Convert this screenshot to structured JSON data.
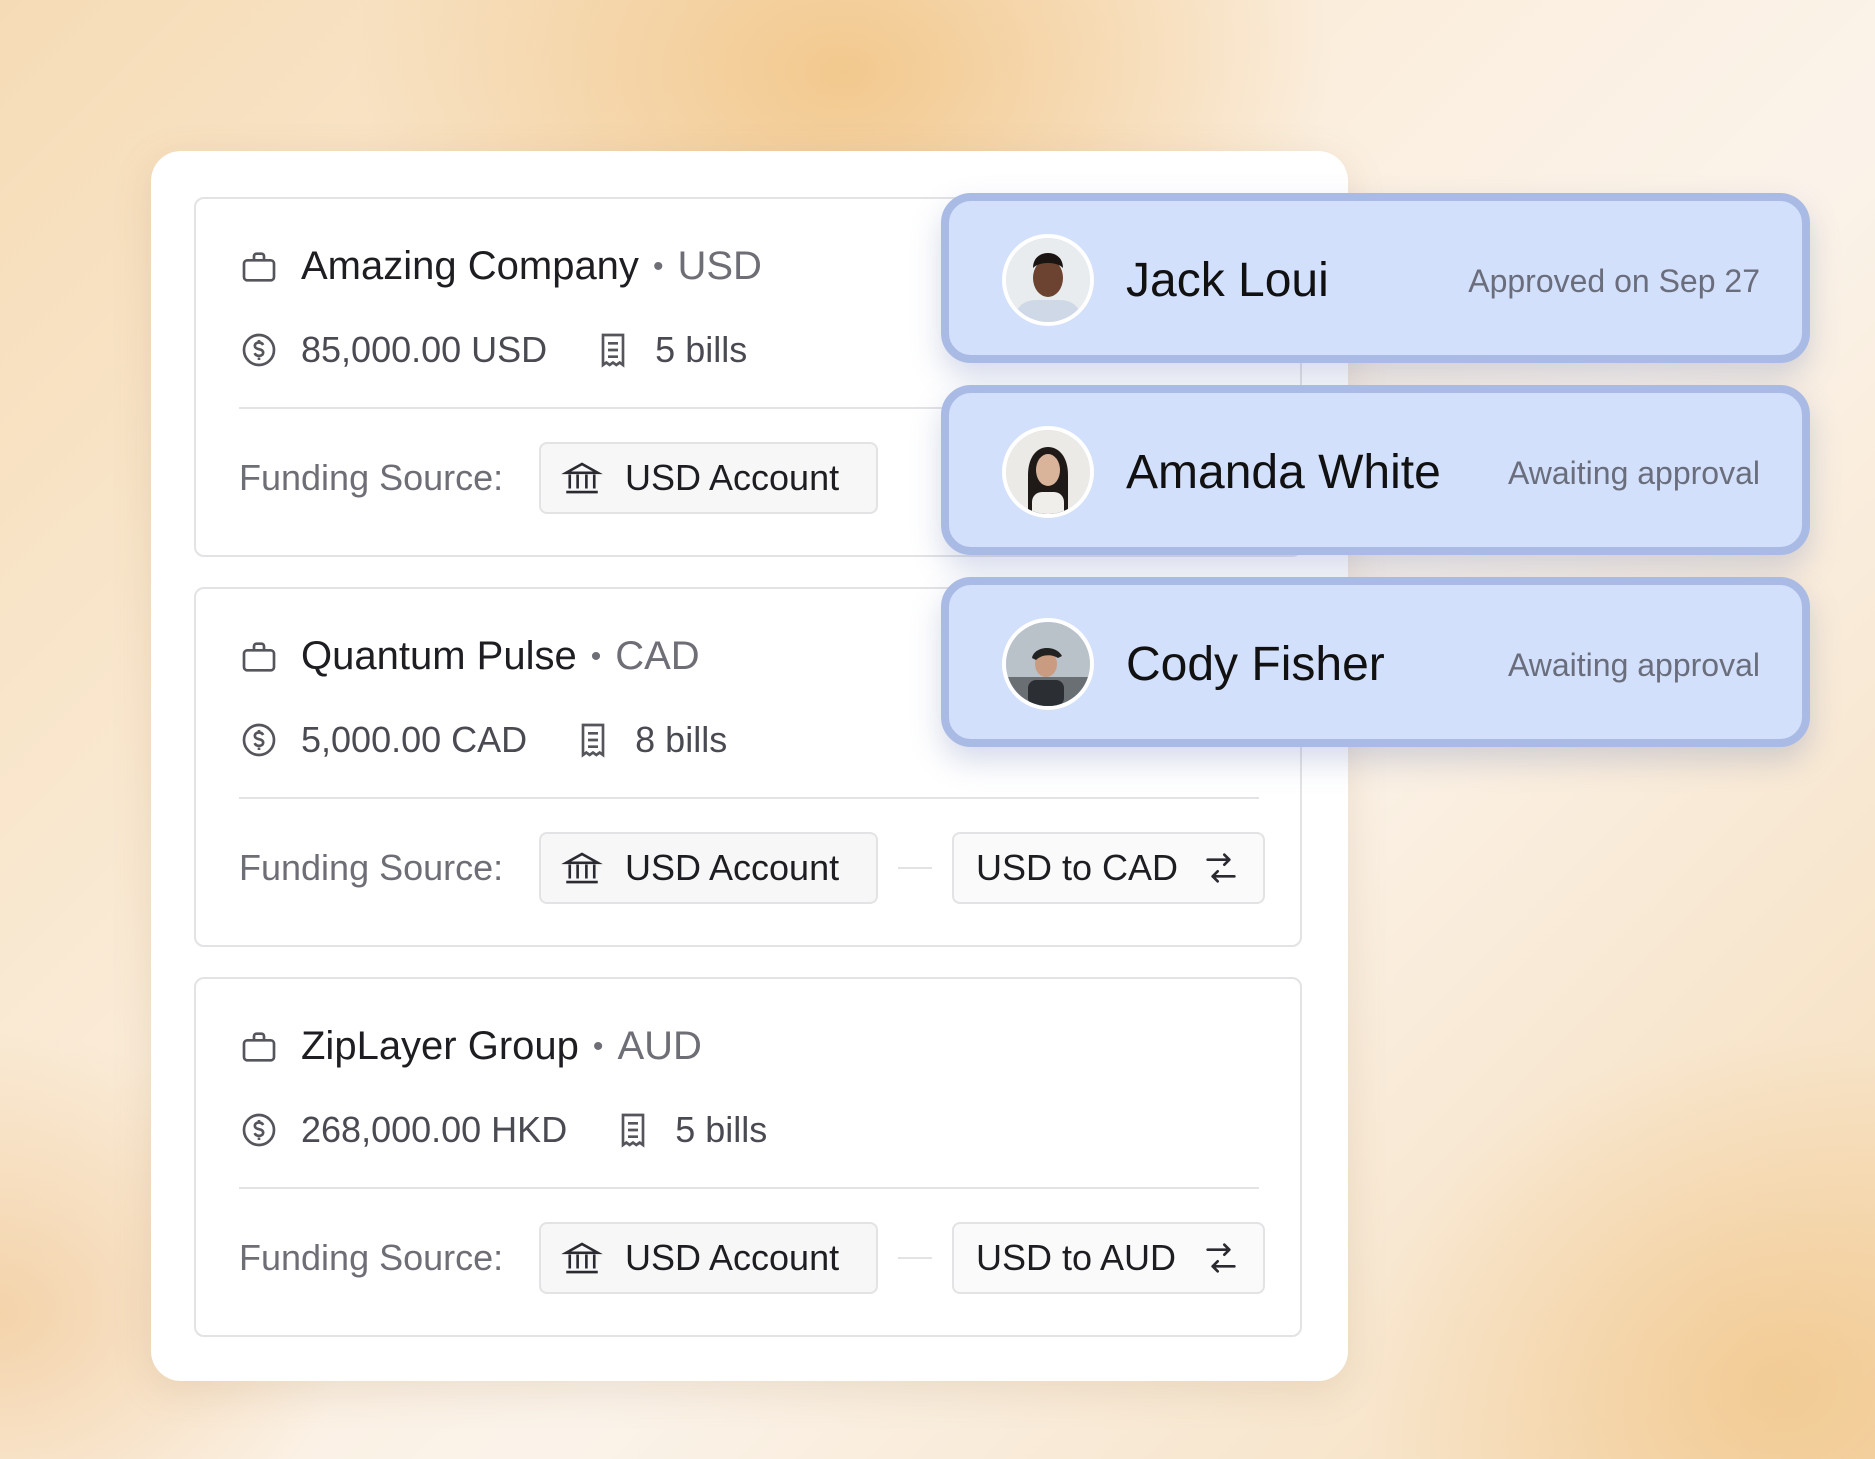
{
  "cards": [
    {
      "company": "Amazing Company",
      "currency": "USD",
      "amount": "85,000.00 USD",
      "bills": "5 bills",
      "funding_label": "Funding Source:",
      "account": "USD Account",
      "conversion": ""
    },
    {
      "company": "Quantum Pulse",
      "currency": "CAD",
      "amount": "5,000.00 CAD",
      "bills": "8 bills",
      "funding_label": "Funding Source:",
      "account": "USD Account",
      "conversion": "USD to CAD"
    },
    {
      "company": "ZipLayer Group",
      "currency": "AUD",
      "amount": "268,000.00 HKD",
      "bills": "5 bills",
      "funding_label": "Funding Source:",
      "account": "USD Account",
      "conversion": "USD to AUD"
    }
  ],
  "approvers": [
    {
      "name": "Jack Loui",
      "status": "Approved on Sep 27"
    },
    {
      "name": "Amanda White",
      "status": "Awaiting approval"
    },
    {
      "name": "Cody Fisher",
      "status": "Awaiting approval"
    }
  ],
  "separator": "•",
  "icons": [
    "briefcase-icon",
    "dollar-circle-icon",
    "receipt-icon",
    "bank-icon",
    "exchange-icon"
  ],
  "colors": {
    "approver_bg": "#d3e0fc",
    "approver_border": "#a9bbe4",
    "panel_bg": "#ffffff"
  }
}
